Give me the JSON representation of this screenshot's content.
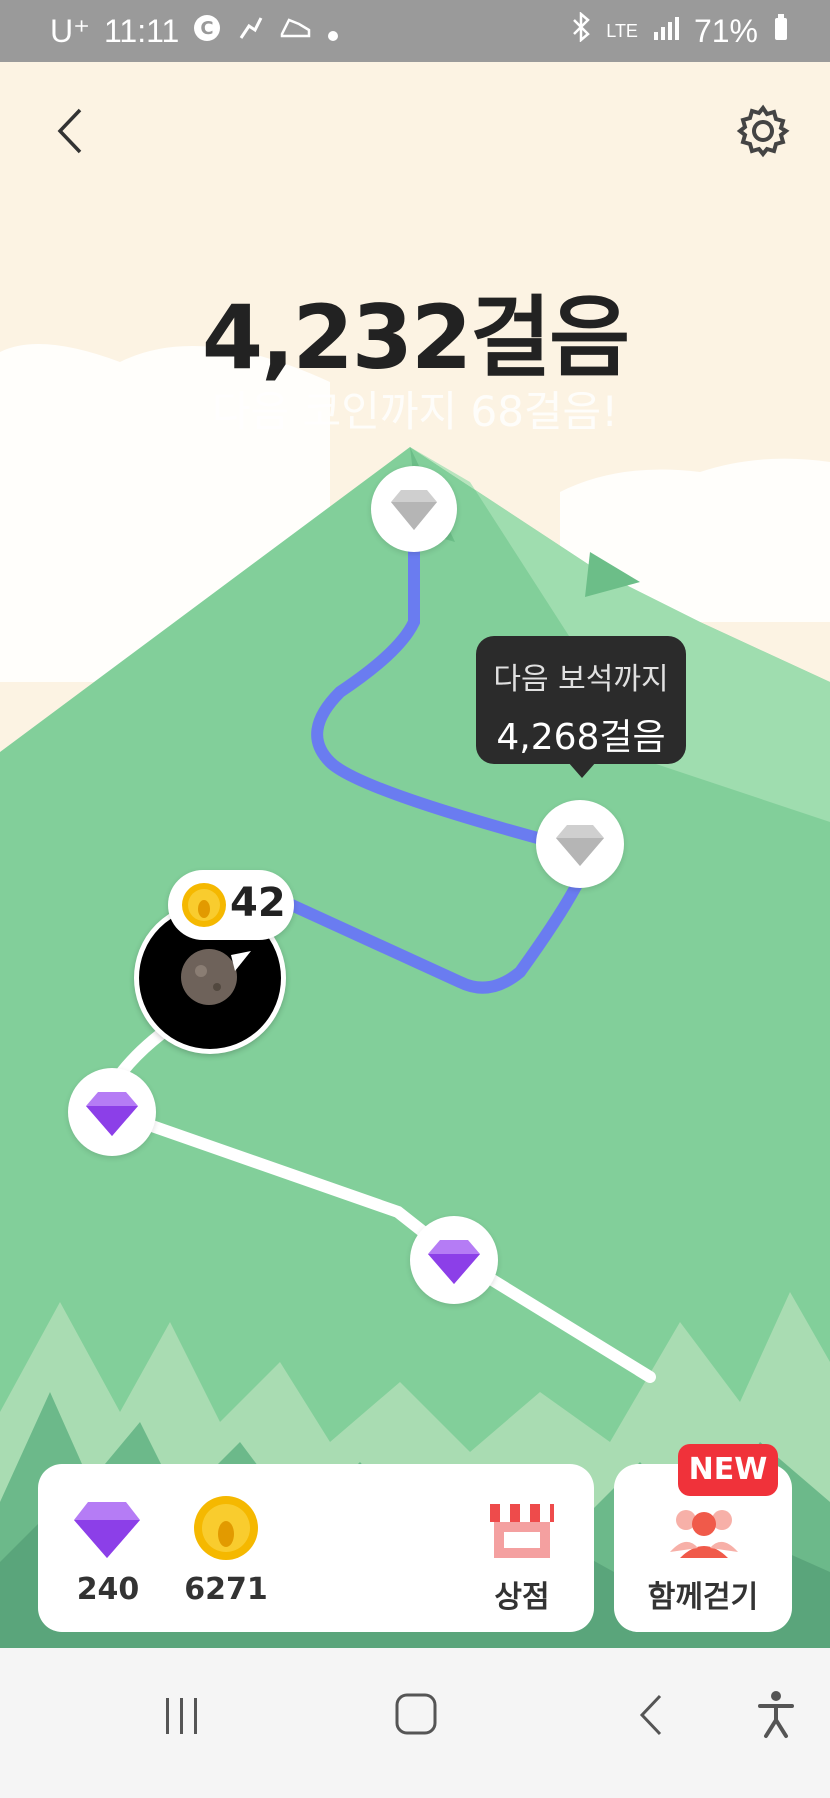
{
  "status": {
    "carrier": "U⁺",
    "time": "11:11",
    "battery": "71%",
    "network": "LTE"
  },
  "header": {
    "back_icon": "chevron-left-icon",
    "settings_icon": "gear-icon"
  },
  "main": {
    "steps": "4,232걸음",
    "next_coin": "다음 코인까지 68걸음!"
  },
  "tooltip": {
    "title": "다음 보석까지",
    "value": "4,268걸음"
  },
  "avatar_coin": {
    "count": "42"
  },
  "bottom": {
    "gems": "240",
    "coins": "6271",
    "shop_label": "상점",
    "walk_together_label": "함께걷기",
    "new_badge": "NEW"
  },
  "colors": {
    "path_done": "#6a7cf0",
    "path_todo": "#ffffff",
    "mountain": "#82cf9a",
    "gem_purple": "#9b4df0",
    "coin_yellow": "#f5b800",
    "badge_red": "#f0323a"
  }
}
